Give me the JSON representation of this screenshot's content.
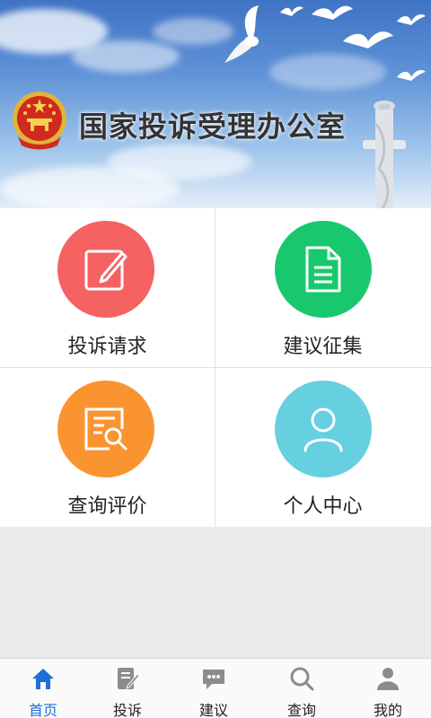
{
  "banner": {
    "title": "国家投诉受理办公室"
  },
  "menu": [
    {
      "label": "投诉请求",
      "color": "#f56262",
      "icon": "edit-icon"
    },
    {
      "label": "建议征集",
      "color": "#19c86e",
      "icon": "document-icon"
    },
    {
      "label": "查询评价",
      "color": "#fa9431",
      "icon": "search-document-icon"
    },
    {
      "label": "个人中心",
      "color": "#66cfe0",
      "icon": "user-icon"
    }
  ],
  "tabbar": {
    "active_color": "#1e6fd9",
    "inactive_color": "#8c8c8c",
    "tabs": [
      {
        "label": "首页",
        "icon": "home-icon",
        "active": true
      },
      {
        "label": "投诉",
        "icon": "edit-icon",
        "active": false
      },
      {
        "label": "建议",
        "icon": "chat-icon",
        "active": false
      },
      {
        "label": "查询",
        "icon": "search-icon",
        "active": false
      },
      {
        "label": "我的",
        "icon": "user-icon",
        "active": false
      }
    ]
  }
}
